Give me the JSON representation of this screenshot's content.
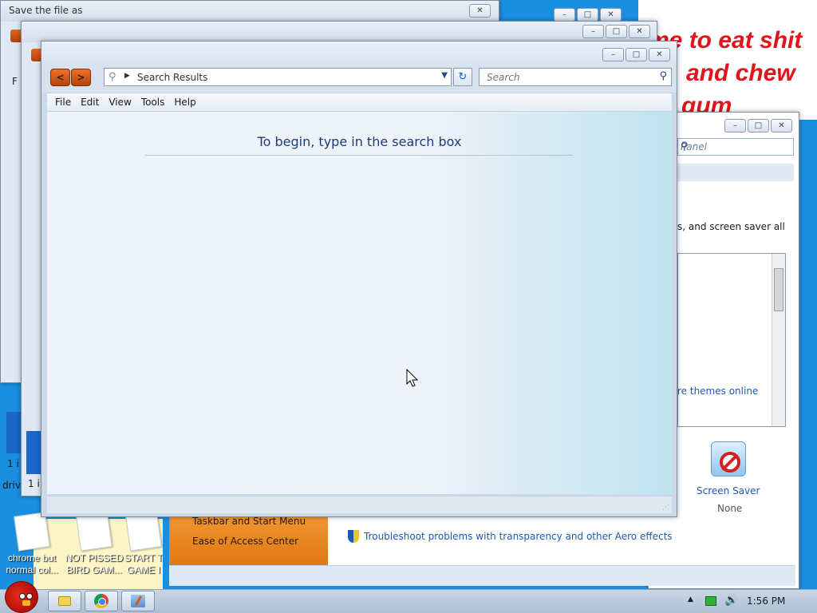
{
  "wallpaper": {
    "line1": "me to eat shit",
    "line2": "and chew",
    "line3": "gum"
  },
  "desktop_icons": [
    {
      "label1": "chrome but",
      "label2": "normal col..."
    },
    {
      "label1": "NOT PISSED",
      "label2": "BIRD GAM..."
    },
    {
      "label1": "START T",
      "label2": "GAME I"
    }
  ],
  "window_save": {
    "title": "Save the file as",
    "partial_text_1": "F",
    "partial_text_2": "1 i",
    "partial_text_3": "driv"
  },
  "window_mid": {
    "partial_text_1": "1 i"
  },
  "caption": {
    "minimize": "–",
    "maximize": "□",
    "close": "✕"
  },
  "explorer": {
    "back_glyph": "<",
    "forward_glyph": ">",
    "address_path": "Search Results",
    "search_placeholder": "Search",
    "menu": [
      "File",
      "Edit",
      "View",
      "Tools",
      "Help"
    ],
    "begin_message": "To begin, type in the search box"
  },
  "personalization": {
    "search_placeholder": "Panel",
    "description": "s, and screen saver all",
    "themes_link": "re themes online",
    "screen_saver_label": "Screen Saver",
    "screen_saver_value": "None"
  },
  "control_panel_bottom": {
    "link_taskbar": "Taskbar and Start Menu",
    "link_ease": "Ease of Access Center",
    "troubleshoot_link": "Troubleshoot problems with transparency and other Aero effects"
  },
  "tray": {
    "time": "1:56 PM",
    "expand_glyph": "▲",
    "volume_glyph": "🔊"
  },
  "icons": {
    "search": "⚲",
    "refresh": "↻",
    "dropdown": "▼",
    "breadcrumb_arrow": "▶",
    "grip": "⋰"
  }
}
